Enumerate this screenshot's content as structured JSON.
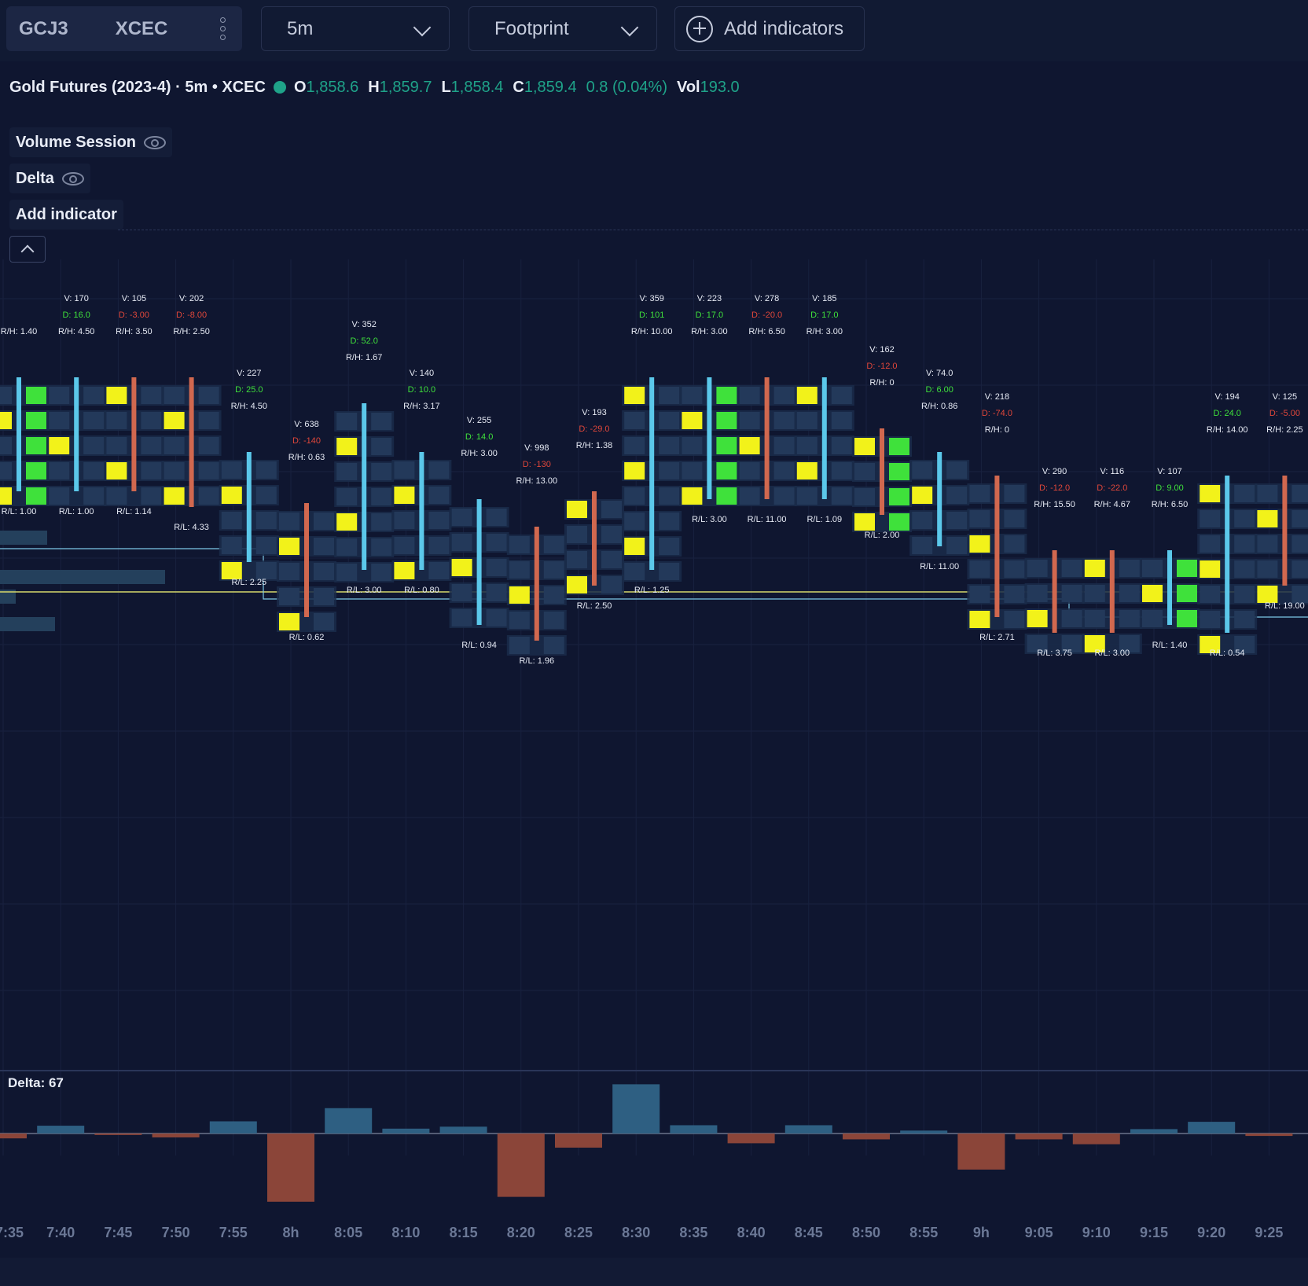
{
  "toolbar": {
    "symbol": "GCJ3",
    "exchange": "XCEC",
    "interval": "5m",
    "chart_type": "Footprint",
    "add_indicators": "Add indicators"
  },
  "legend": {
    "title": "Gold Futures (2023-4) · 5m • XCEC",
    "o_key": "O",
    "o_val": "1,858.6",
    "h_key": "H",
    "h_val": "1,859.7",
    "l_key": "L",
    "l_val": "1,858.4",
    "c_key": "C",
    "c_val": "1,859.4",
    "change": "0.8 (0.04%)",
    "vol_key": "Vol",
    "vol_val": "193.0"
  },
  "indicators": {
    "volume_session": "Volume Session",
    "delta": "Delta",
    "add": "Add indicator"
  },
  "delta_label": "Delta: 67",
  "colors": {
    "background": "#0f1630",
    "positive": "#2e5f82",
    "negative": "#8b4539",
    "highlight": "#f2f21a",
    "buy": "#3fe13b",
    "wick": "#5bc8ea",
    "poc_line": "#d6d86a"
  },
  "chart_data": {
    "type": "bar",
    "x": [
      "7:35",
      "7:40",
      "7:45",
      "7:50",
      "7:55",
      "8h",
      "8:05",
      "8:10",
      "8:15",
      "8:20",
      "8:25",
      "8:30",
      "8:35",
      "8:40",
      "8:45",
      "8:50",
      "8:55",
      "9h",
      "9:05",
      "9:10",
      "9:15",
      "9:20",
      "9:25"
    ],
    "delta_values": [
      -10,
      16,
      -3,
      -8,
      25,
      -140,
      52,
      10,
      14,
      -130,
      -29,
      101,
      17,
      -20,
      17,
      -12,
      6,
      -74,
      -12,
      -22,
      9,
      24,
      -5
    ],
    "footprint": [
      {
        "v": "",
        "d": "",
        "r": "R/H: 1.40"
      },
      {
        "v": "V: 170",
        "d": "D: 16.0",
        "r": "R/H: 4.50"
      },
      {
        "v": "V: 105",
        "d": "D: -3.00",
        "r": "R/H: 3.50"
      },
      {
        "v": "V: 202",
        "d": "D: -8.00",
        "r": "R/H: 2.50"
      },
      {
        "v": "V: 227",
        "d": "D: 25.0",
        "r": "R/H: 4.50"
      },
      {
        "v": "V: 638",
        "d": "D: -140",
        "r": "R/H: 0.63"
      },
      {
        "v": "V: 352",
        "d": "D: 52.0",
        "r": "R/H: 1.67"
      },
      {
        "v": "V: 140",
        "d": "D: 10.0",
        "r": "R/H: 3.17"
      },
      {
        "v": "V: 255",
        "d": "D: 14.0",
        "r": "R/H: 3.00"
      },
      {
        "v": "V: 998",
        "d": "D: -130",
        "r": "R/H: 13.00"
      },
      {
        "v": "V: 193",
        "d": "D: -29.0",
        "r": "R/H: 1.38"
      },
      {
        "v": "V: 359",
        "d": "D: 101",
        "r": "R/H: 10.00"
      },
      {
        "v": "V: 223",
        "d": "D: 17.0",
        "r": "R/H: 3.00"
      },
      {
        "v": "V: 278",
        "d": "D: -20.0",
        "r": "R/H: 6.50"
      },
      {
        "v": "V: 185",
        "d": "D: 17.0",
        "r": "R/H: 3.00"
      },
      {
        "v": "V: 162",
        "d": "D: -12.0",
        "r": "R/H: 0"
      },
      {
        "v": "V: 74.0",
        "d": "D: 6.00",
        "r": "R/H: 0.86"
      },
      {
        "v": "V: 218",
        "d": "D: -74.0",
        "r": "R/H: 0"
      },
      {
        "v": "V: 290",
        "d": "D: -12.0",
        "r": "R/H: 15.50"
      },
      {
        "v": "V: 116",
        "d": "D: -22.0",
        "r": "R/H: 4.67"
      },
      {
        "v": "V: 107",
        "d": "D: 9.00",
        "r": "R/H: 6.50"
      },
      {
        "v": "V: 194",
        "d": "D: 24.0",
        "r": "R/H: 14.00"
      },
      {
        "v": "V: 125",
        "d": "D: -5.00",
        "r": "R/H: 2.25"
      }
    ],
    "rl": [
      "R/L: 1.00",
      "R/L: 1.00",
      "R/L: 1.14",
      "R/L: 4.33",
      "R/L: 2.25",
      "R/L: 0.62",
      "R/L: 3.00",
      "R/L: 0.80",
      "R/L: 0.94",
      "R/L: 1.96",
      "R/L: 2.50",
      "R/L: 1.25",
      "R/L: 3.00",
      "R/L: 11.00",
      "R/L: 1.09",
      "R/L: 2.00",
      "R/L: 11.00",
      "R/L: 2.71",
      "R/L: 3.75",
      "R/L: 3.00",
      "R/L: 1.40",
      "R/L: 0.54",
      "R/L: 19.00"
    ],
    "ylabel": "",
    "xlabel": ""
  }
}
